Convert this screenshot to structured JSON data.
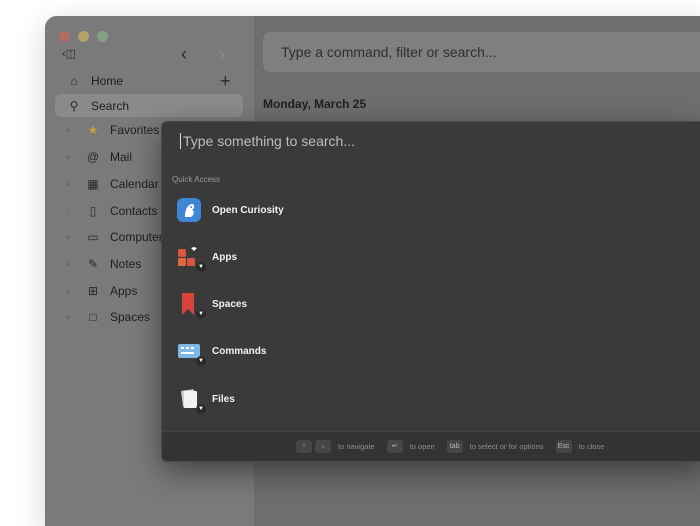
{
  "sidebar": {
    "home_label": "Home",
    "search_label": "Search",
    "items": [
      {
        "label": "Favorites",
        "icon": "star-icon"
      },
      {
        "label": "Mail",
        "icon": "at-icon"
      },
      {
        "label": "Calendar",
        "icon": "calendar-icon"
      },
      {
        "label": "Contacts",
        "icon": "contacts-icon"
      },
      {
        "label": "Computer",
        "icon": "folder-icon"
      },
      {
        "label": "Notes",
        "icon": "note-icon"
      },
      {
        "label": "Apps",
        "icon": "grid-icon"
      },
      {
        "label": "Spaces",
        "icon": "bookmark-icon"
      }
    ]
  },
  "command_bar": {
    "placeholder": "Type a command, filter or search..."
  },
  "main": {
    "date": "Monday, March 25"
  },
  "palette": {
    "search_placeholder": "Type something to search...",
    "section_label": "Quick Access",
    "items": [
      {
        "label": "Open Curiosity",
        "icon": "curiosity-app-icon"
      },
      {
        "label": "Apps",
        "icon": "apps-icon"
      },
      {
        "label": "Spaces",
        "icon": "spaces-icon"
      },
      {
        "label": "Commands",
        "icon": "commands-icon"
      },
      {
        "label": "Files",
        "icon": "files-icon"
      }
    ],
    "footer": {
      "navigate": "to navigate",
      "open": "to open",
      "tab_key": "tab",
      "options": "to select or for options",
      "esc_key": "Esc",
      "close": "to close"
    }
  }
}
